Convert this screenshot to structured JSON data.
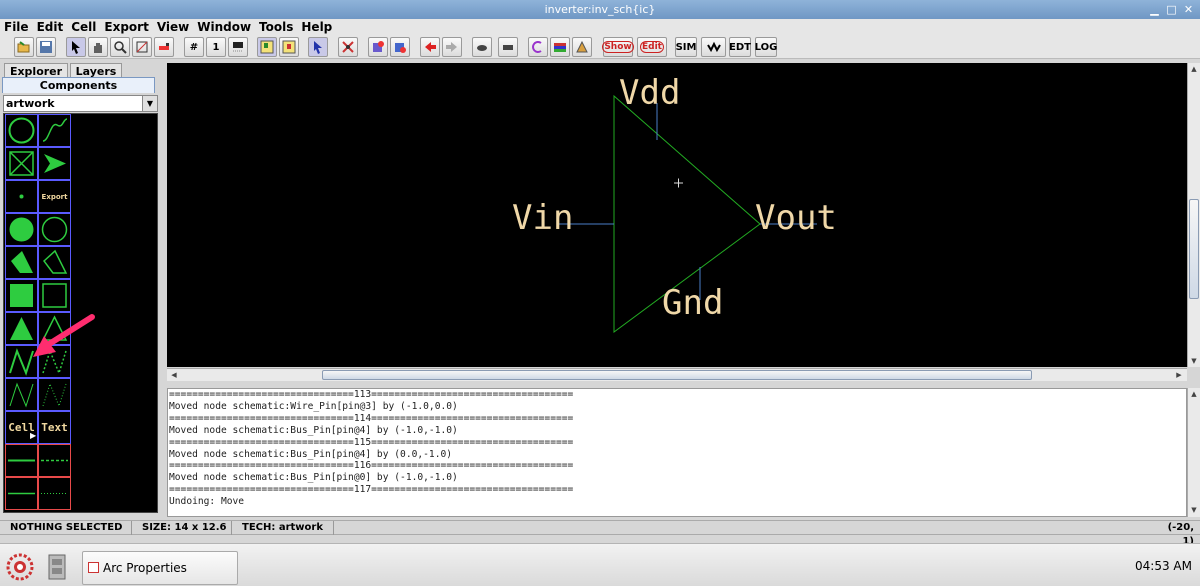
{
  "window": {
    "title": "inverter:inv_sch{ic}"
  },
  "menu": [
    "File",
    "Edit",
    "Cell",
    "Export",
    "View",
    "Window",
    "Tools",
    "Help"
  ],
  "toolbar": {
    "grid_one_label": "1",
    "show_label": "Show",
    "edit_label": "Edit",
    "sim_label": "SIM",
    "edt_label": "EDT",
    "log_label": "LOG"
  },
  "left_panel": {
    "tabs": [
      "Explorer",
      "Layers",
      "Components"
    ],
    "active_tab": "Components",
    "library": "artwork",
    "cell_label": "Cell",
    "text_label": "Text",
    "export_label": "Export"
  },
  "canvas": {
    "labels": {
      "vdd": "Vdd",
      "vin": "Vin",
      "vout": "Vout",
      "gnd": "Gnd"
    },
    "colors": {
      "outline": "#22aa22",
      "wire": "#4a7ec8",
      "text": "#f0d8a8",
      "background": "#000000"
    }
  },
  "log": {
    "lines": [
      "================================113===================================",
      "Moved node schematic:Wire_Pin[pin@3] by (-1.0,0.0)",
      "================================114===================================",
      "Moved node schematic:Bus_Pin[pin@4] by (-1.0,-1.0)",
      "================================115===================================",
      "Moved node schematic:Bus_Pin[pin@4] by (0.0,-1.0)",
      "================================116===================================",
      "Moved node schematic:Bus_Pin[pin@0] by (-1.0,-1.0)",
      "================================117===================================",
      "Undoing: Move"
    ]
  },
  "status": {
    "selection": "NOTHING SELECTED",
    "size": "SIZE: 14 x 12.6",
    "tech": "TECH: artwork",
    "coords": "(-20, 1)"
  },
  "taskbar": {
    "task_label": "Arc Properties",
    "clock": "04:53 AM"
  },
  "annotation_color": "#ff2d6f"
}
